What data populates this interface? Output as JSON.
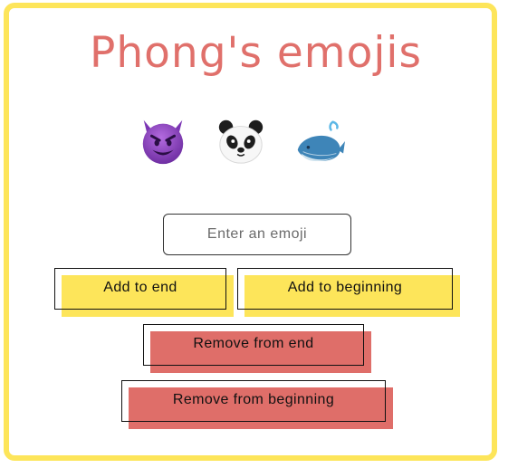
{
  "app": {
    "title": "Phong's emojis"
  },
  "emojis": [
    {
      "icon": "smiling-imp-icon",
      "char": "😈"
    },
    {
      "icon": "panda-face-icon",
      "char": "🐼"
    },
    {
      "icon": "whale-icon",
      "char": "🐳"
    }
  ],
  "input": {
    "placeholder": "Enter an emoji",
    "value": ""
  },
  "buttons": {
    "add_end": "Add to end",
    "add_beginning": "Add to beginning",
    "remove_end": "Remove from end",
    "remove_beginning": "Remove from beginning"
  },
  "colors": {
    "border": "#fde55a",
    "title": "#e0706b",
    "add_fill": "#fde55a",
    "remove_fill": "#df6e69"
  }
}
